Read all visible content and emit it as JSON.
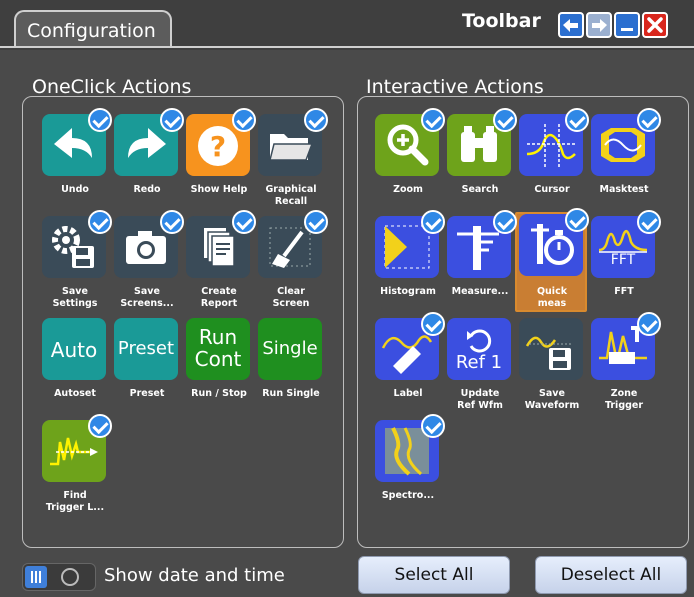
{
  "tab": {
    "label": "Configuration"
  },
  "toolbar": {
    "label": "Toolbar"
  },
  "oneclick": {
    "title": "OneClick Actions",
    "items": [
      {
        "label": "Undo"
      },
      {
        "label": "Redo"
      },
      {
        "label": "Show Help"
      },
      {
        "label": "Graphical\nRecall"
      },
      {
        "label": "Save\nSettings"
      },
      {
        "label": "Save\nScreens..."
      },
      {
        "label": "Create\nReport"
      },
      {
        "label": "Clear\nScreen"
      },
      {
        "label": "Autoset",
        "icon_text": "Auto"
      },
      {
        "label": "Preset",
        "icon_text": "Preset"
      },
      {
        "label": "Run / Stop",
        "icon_text": "Run\nCont"
      },
      {
        "label": "Run Single",
        "icon_text": "Single"
      },
      {
        "label": "Find\nTrigger L..."
      }
    ]
  },
  "interactive": {
    "title": "Interactive Actions",
    "items": [
      {
        "label": "Zoom"
      },
      {
        "label": "Search"
      },
      {
        "label": "Cursor"
      },
      {
        "label": "Masktest"
      },
      {
        "label": "Histogram"
      },
      {
        "label": "Measure..."
      },
      {
        "label": "Quick\nmeas"
      },
      {
        "label": "FFT",
        "icon_text": "FFT"
      },
      {
        "label": "Label"
      },
      {
        "label": "Update\nRef Wfm",
        "icon_text": "Ref 1"
      },
      {
        "label": "Save\nWaveform"
      },
      {
        "label": "Zone\nTrigger"
      },
      {
        "label": "Spectro..."
      }
    ]
  },
  "footer": {
    "show_date_time": "Show date and time",
    "select_all": "Select All",
    "deselect_all": "Deselect All"
  },
  "colors": {
    "teal": "#1a9a97",
    "green": "#1f8f1f",
    "lime": "#6ea31b",
    "blue": "#3b4fe0",
    "orange": "#f7931e",
    "slate": "#3a4b58",
    "check": "#2f88e6"
  }
}
